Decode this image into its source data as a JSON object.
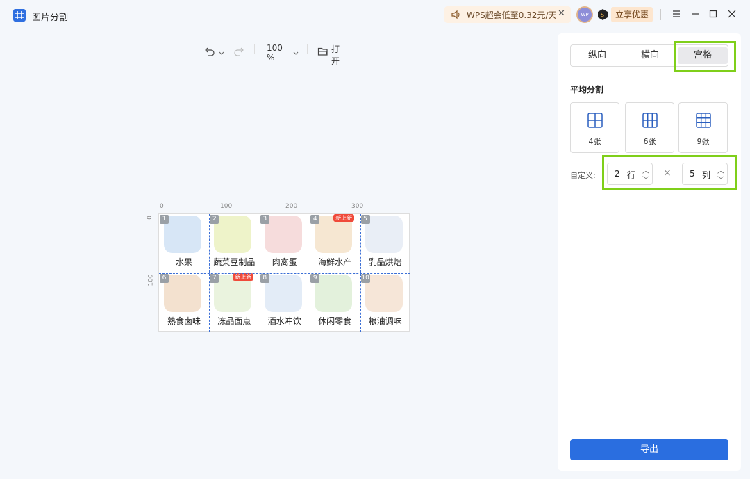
{
  "titlebar": {
    "title": "图片分割",
    "promo_text": "WPS超会低至0.32元/天",
    "avatar_text": "WP",
    "claim_label": "立享优惠",
    "icons": [
      "app-logo-icon",
      "speaker-icon",
      "close-icon",
      "vip-icon",
      "menu-icon",
      "minimize-icon",
      "maximize-icon",
      "window-close-icon"
    ]
  },
  "toolbar": {
    "zoom": "100 %",
    "open_label": "打开"
  },
  "canvas": {
    "ruler_x": [
      "0",
      "100",
      "200",
      "300"
    ],
    "ruler_y": [
      "0",
      "100"
    ],
    "grid": {
      "rows": 2,
      "cols": 5
    },
    "cells": [
      {
        "num": "1",
        "label": "水果",
        "color": "#d7e6f6",
        "tag": ""
      },
      {
        "num": "2",
        "label": "蔬菜豆制品",
        "color": "#eef3c9",
        "tag": ""
      },
      {
        "num": "3",
        "label": "肉禽蛋",
        "color": "#f6dcdc",
        "tag": ""
      },
      {
        "num": "4",
        "label": "海鲜水产",
        "color": "#f6e7d2",
        "tag": "新上新"
      },
      {
        "num": "5",
        "label": "乳品烘焙",
        "color": "#e9eef6",
        "tag": ""
      },
      {
        "num": "6",
        "label": "熟食卤味",
        "color": "#f3e1cf",
        "tag": ""
      },
      {
        "num": "7",
        "label": "冻品面点",
        "color": "#eaf3de",
        "tag": "新上新"
      },
      {
        "num": "8",
        "label": "酒水冲饮",
        "color": "#e3ecf7",
        "tag": ""
      },
      {
        "num": "9",
        "label": "休闲零食",
        "color": "#e3f1dc",
        "tag": ""
      },
      {
        "num": "10",
        "label": "粮油调味",
        "color": "#f6e6d8",
        "tag": ""
      }
    ]
  },
  "panel": {
    "tabs": [
      "纵向",
      "横向",
      "宫格"
    ],
    "active_tab": "宫格",
    "section_title": "平均分割",
    "presets": [
      "4张",
      "6张",
      "9张"
    ],
    "custom_label": "自定义:",
    "rows_value": "2",
    "rows_unit": "行",
    "cols_value": "5",
    "cols_unit": "列",
    "times": "×",
    "export_label": "导出",
    "accent_color": "#2a6ee0",
    "highlight_color": "#7fcf1a"
  }
}
